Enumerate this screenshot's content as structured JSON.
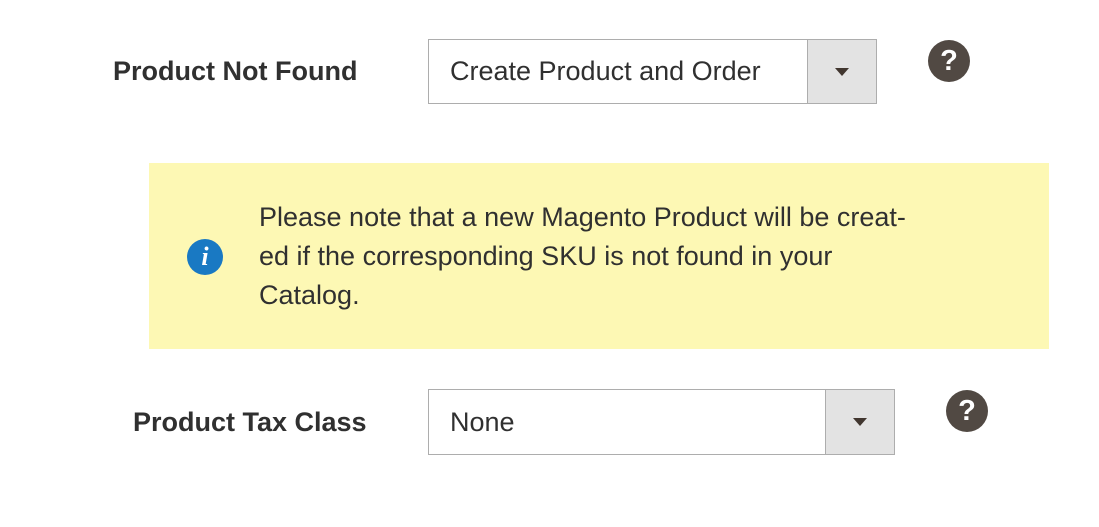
{
  "product_not_found": {
    "label": "Product Not Found",
    "selected_value": "Create Product and Order",
    "help_glyph": "?"
  },
  "notice": {
    "icon_glyph": "i",
    "lines": [
      "Please note that a new Magento Product will be creat-",
      "ed if the corresponding SKU is not found in your",
      "Catalog."
    ]
  },
  "product_tax_class": {
    "label": "Product Tax Class",
    "selected_value": "None",
    "help_glyph": "?"
  },
  "colors": {
    "notice_background": "#fdf8b4",
    "info_icon": "#1979c3",
    "help_icon": "#514943",
    "select_border": "#adadad",
    "select_arrow_bg": "#e3e3e3"
  },
  "icons": {
    "help": "question-circle-icon",
    "info": "info-circle-icon",
    "select_arrow": "chevron-down-icon"
  }
}
